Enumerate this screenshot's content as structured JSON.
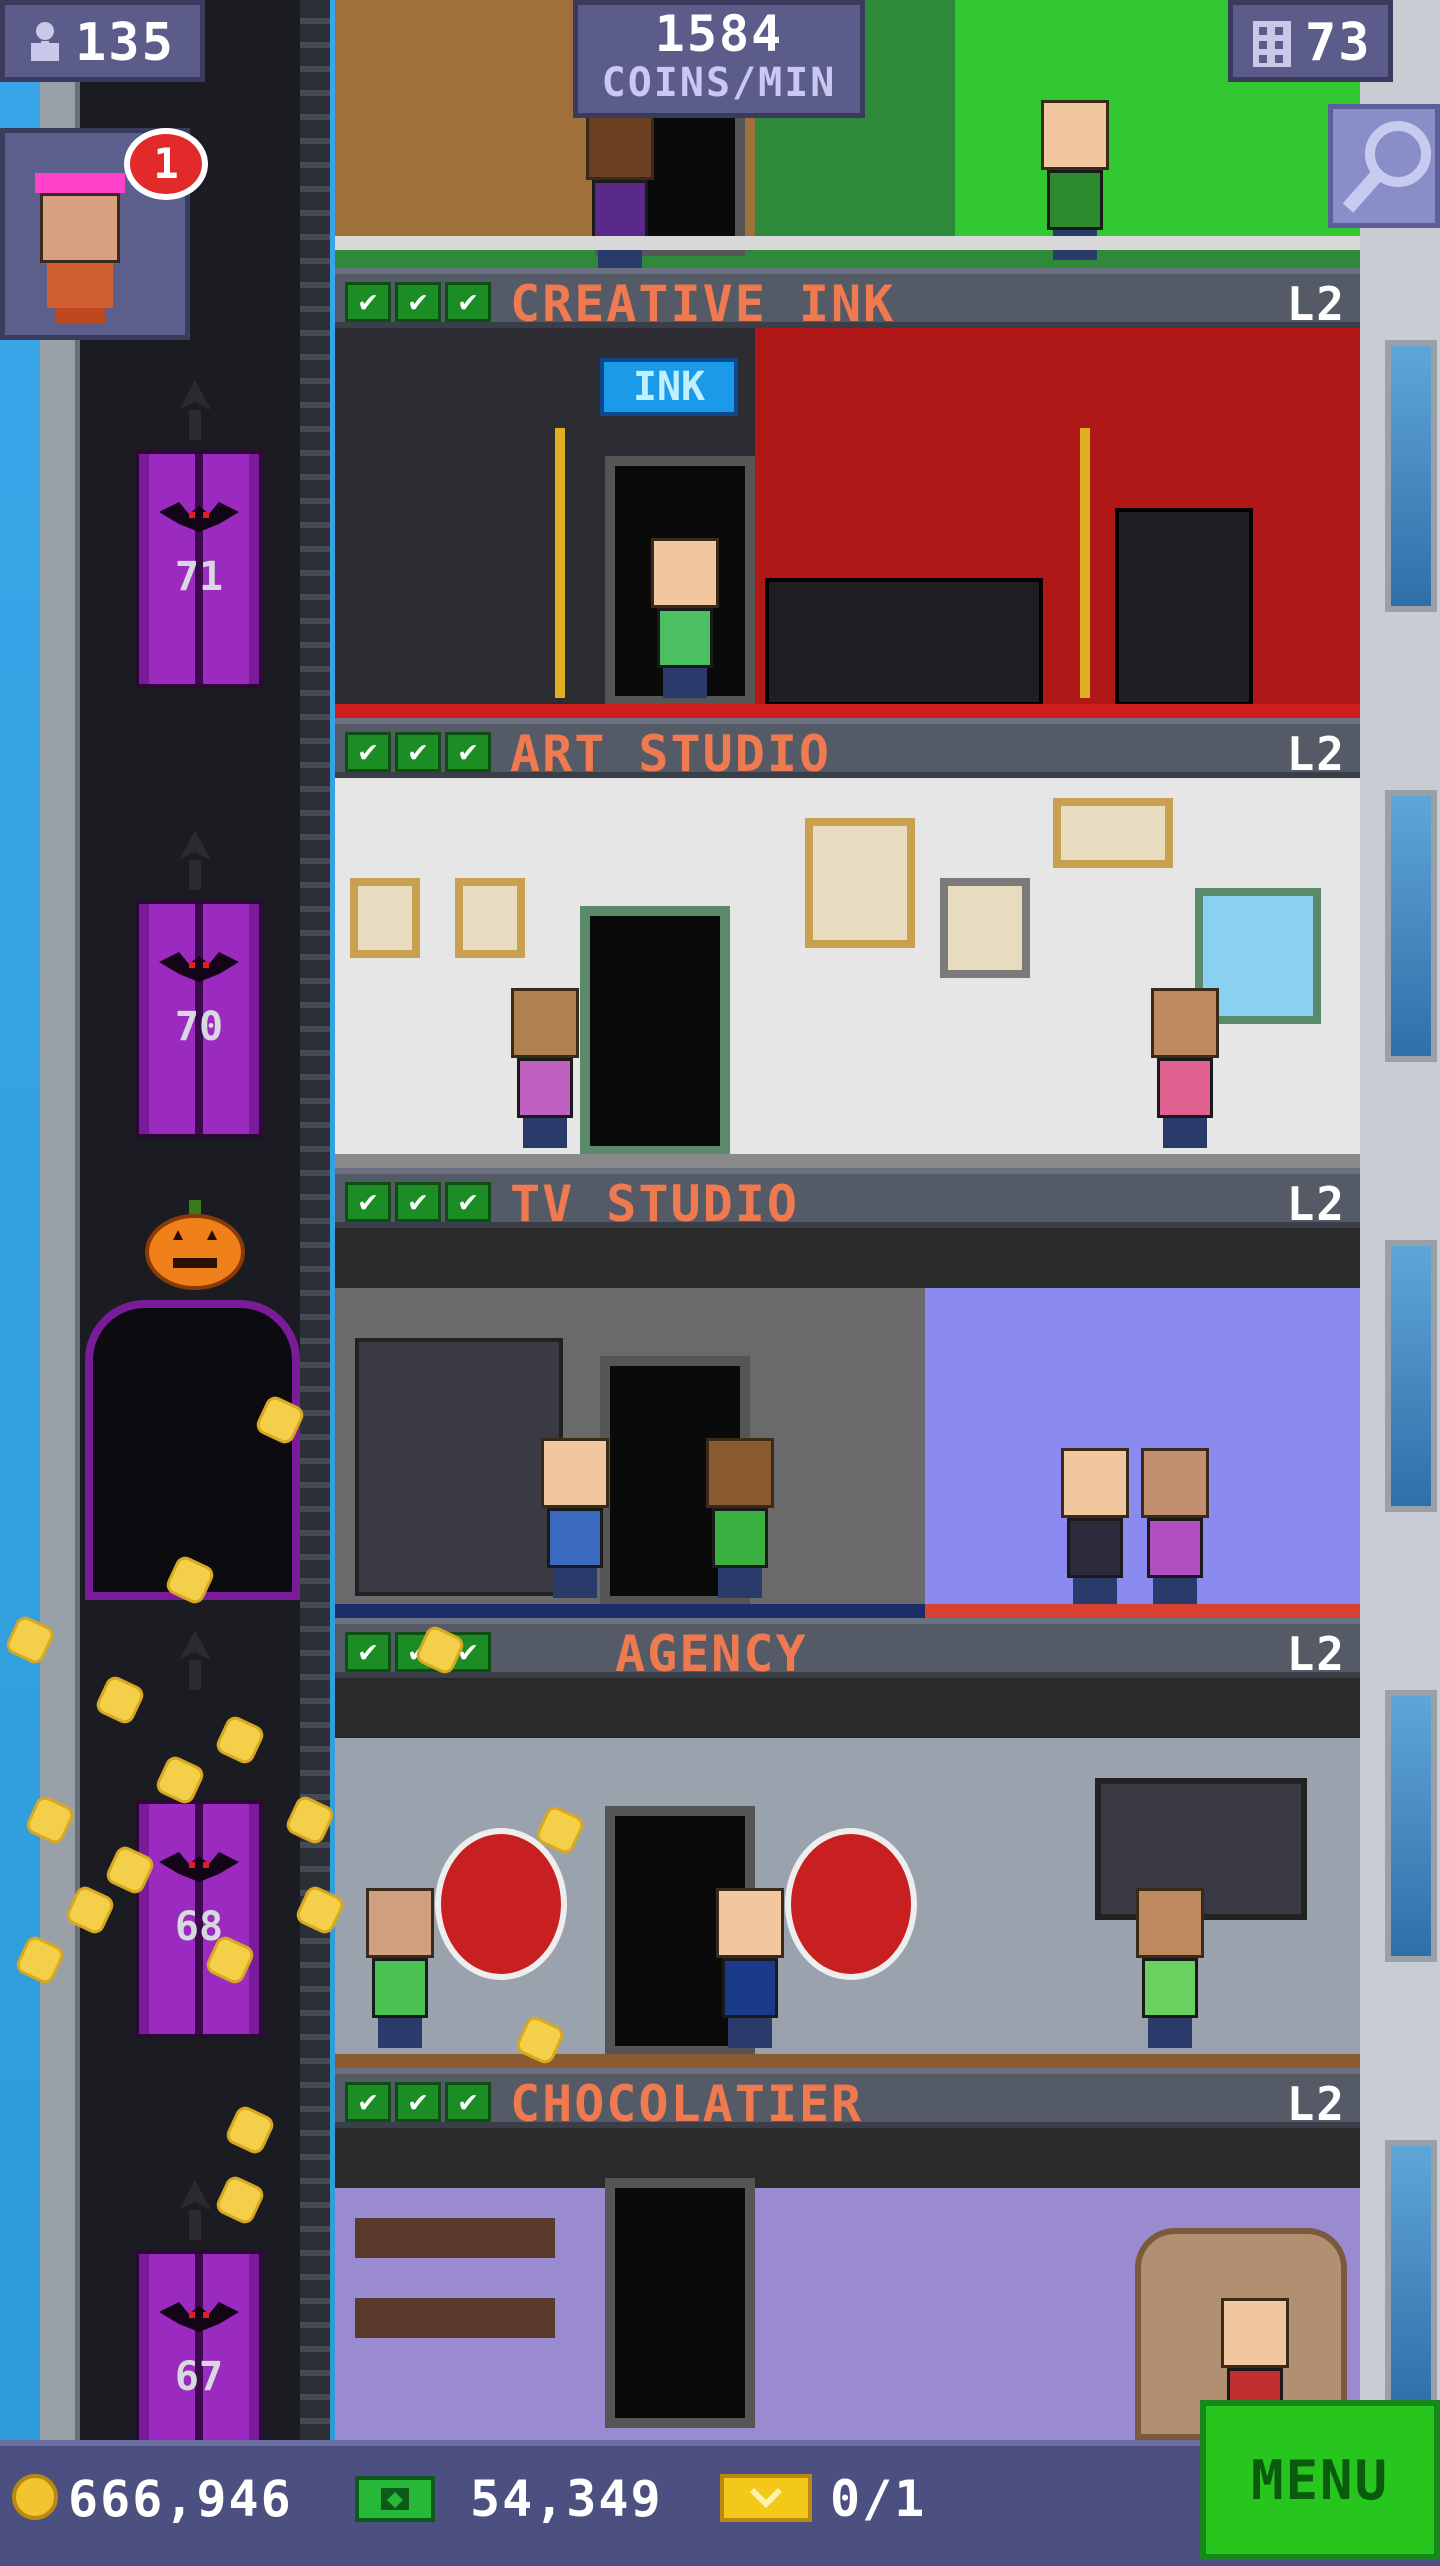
{
  "hud": {
    "population": "135",
    "coins_per_min_value": "1584",
    "coins_per_min_label": "COINS/MIN",
    "floors_count": "73",
    "visitor_notifications": "1"
  },
  "elevator": {
    "floor_numbers": [
      "71",
      "70",
      "68",
      "67"
    ]
  },
  "floors": [
    {
      "name": "CREATIVE INK",
      "level": "L2",
      "sign": "INK",
      "checks": 3
    },
    {
      "name": "ART STUDIO",
      "level": "L2",
      "checks": 3
    },
    {
      "name": "TV STUDIO",
      "level": "L2",
      "checks": 3
    },
    {
      "name": "AGENCY",
      "level": "L2",
      "checks": 3
    },
    {
      "name": "CHOCOLATIER",
      "level": "L2",
      "checks": 3
    }
  ],
  "bottom_bar": {
    "coins": "666,946",
    "bux": "54,349",
    "tickets": "0/1",
    "menu_label": "MENU"
  },
  "colors": {
    "floor_name": "#f07a50",
    "hud_bg": "#5c5c8a",
    "menu_green": "#26c61e",
    "elevator_purple": "#9b2ac0"
  }
}
